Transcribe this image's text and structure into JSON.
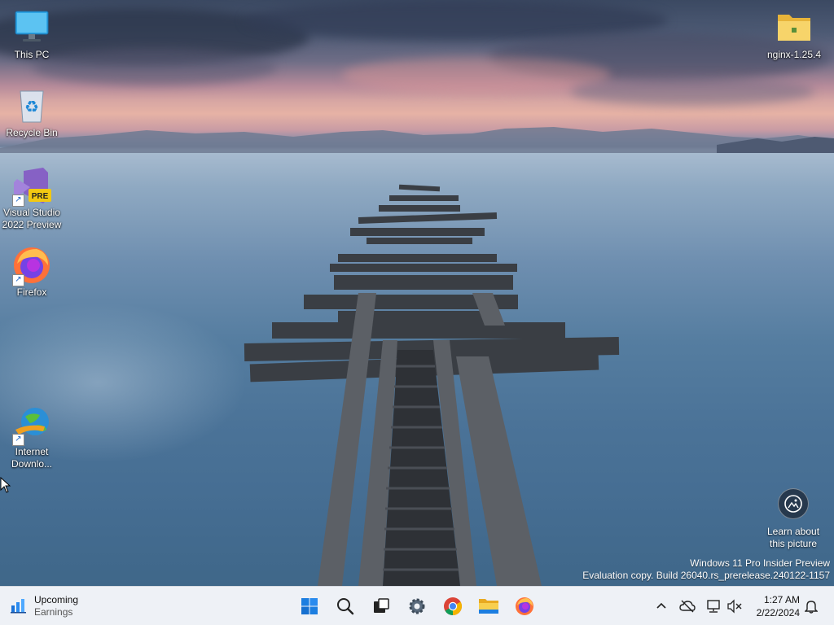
{
  "desktop": {
    "icons": [
      {
        "label": "This PC",
        "icon": "monitor-icon"
      },
      {
        "label": "Recycle Bin",
        "icon": "recycle-bin-icon"
      },
      {
        "label": "Visual Studio 2022 Preview",
        "icon": "visual-studio-preview-icon",
        "badge": "PRE"
      },
      {
        "label": "Firefox",
        "icon": "firefox-icon"
      },
      {
        "label": "Internet Downlo...",
        "icon": "internet-download-manager-icon"
      },
      {
        "label": "nginx-1.25.4",
        "icon": "folder-icon"
      }
    ],
    "learn_about": {
      "label": "Learn about this picture",
      "icon": "camera-info-icon"
    },
    "watermark": {
      "line1": "Windows 11 Pro Insider Preview",
      "line2": "Evaluation copy. Build 26040.rs_prerelease.240122-1157"
    }
  },
  "taskbar": {
    "widget": {
      "title": "Upcoming",
      "subtitle": "Earnings",
      "icon": "stocks-chart-icon"
    },
    "pinned": [
      {
        "name": "start",
        "icon": "windows-logo-icon"
      },
      {
        "name": "search",
        "icon": "search-icon"
      },
      {
        "name": "task-view",
        "icon": "task-view-icon"
      },
      {
        "name": "settings",
        "icon": "gear-icon"
      },
      {
        "name": "chrome",
        "icon": "chrome-icon"
      },
      {
        "name": "file-explorer",
        "icon": "folder-icon"
      },
      {
        "name": "firefox",
        "icon": "firefox-icon"
      }
    ],
    "tray": [
      {
        "name": "show-hidden",
        "icon": "chevron-up-icon"
      },
      {
        "name": "onedrive",
        "icon": "cloud-off-icon"
      },
      {
        "name": "network",
        "icon": "network-icon"
      },
      {
        "name": "volume",
        "icon": "volume-muted-icon"
      }
    ],
    "clock": {
      "time": "1:27 AM",
      "date": "2/22/2024"
    },
    "notifications": {
      "icon": "bell-icon"
    }
  }
}
